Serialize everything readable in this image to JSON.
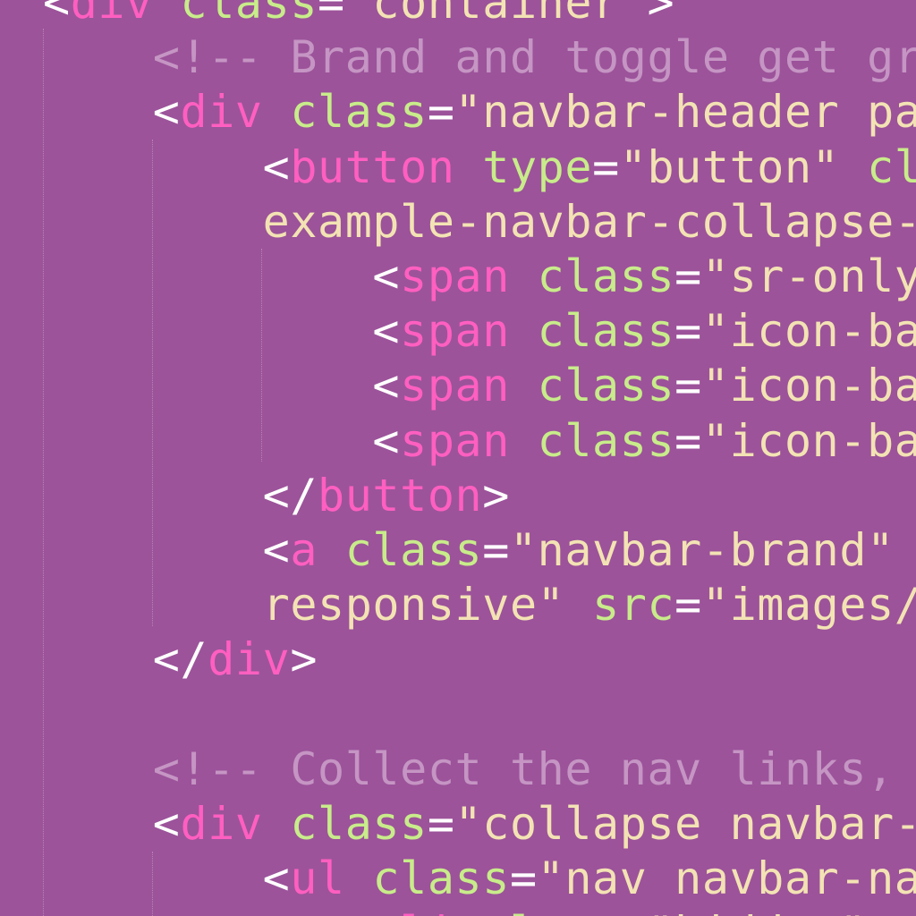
{
  "theme": {
    "background": "#9c539a",
    "tag": "#ff5fc0",
    "attribute": "#c8ec8a",
    "string": "#f3e3b4",
    "punctuation": "#ffffff",
    "comment": "#c595c3",
    "indent_guide": "rgba(255,255,255,0.28)"
  },
  "code_lines": [
    {
      "tokens": [
        {
          "t": "punc",
          "v": "<"
        },
        {
          "t": "tag",
          "v": "div"
        },
        {
          "t": "punc",
          "v": " "
        },
        {
          "t": "attr",
          "v": "class"
        },
        {
          "t": "punc",
          "v": "="
        },
        {
          "t": "str",
          "v": "\"container\""
        },
        {
          "t": "punc",
          "v": ">"
        }
      ]
    },
    {
      "tokens": [
        {
          "t": "punc",
          "v": "    "
        },
        {
          "t": "com",
          "v": "<!-- Brand and toggle get gr"
        }
      ]
    },
    {
      "tokens": [
        {
          "t": "punc",
          "v": "    <"
        },
        {
          "t": "tag",
          "v": "div"
        },
        {
          "t": "punc",
          "v": " "
        },
        {
          "t": "attr",
          "v": "class"
        },
        {
          "t": "punc",
          "v": "="
        },
        {
          "t": "str",
          "v": "\"navbar-header pa"
        }
      ]
    },
    {
      "tokens": [
        {
          "t": "punc",
          "v": "        <"
        },
        {
          "t": "tag",
          "v": "button"
        },
        {
          "t": "punc",
          "v": " "
        },
        {
          "t": "attr",
          "v": "type"
        },
        {
          "t": "punc",
          "v": "="
        },
        {
          "t": "str",
          "v": "\"button\" "
        },
        {
          "t": "attr",
          "v": "cl"
        }
      ]
    },
    {
      "tokens": [
        {
          "t": "str",
          "v": "        example-navbar-collapse-"
        }
      ]
    },
    {
      "tokens": [
        {
          "t": "punc",
          "v": "            <"
        },
        {
          "t": "tag",
          "v": "span"
        },
        {
          "t": "punc",
          "v": " "
        },
        {
          "t": "attr",
          "v": "class"
        },
        {
          "t": "punc",
          "v": "="
        },
        {
          "t": "str",
          "v": "\"sr-only"
        }
      ]
    },
    {
      "tokens": [
        {
          "t": "punc",
          "v": "            <"
        },
        {
          "t": "tag",
          "v": "span"
        },
        {
          "t": "punc",
          "v": " "
        },
        {
          "t": "attr",
          "v": "class"
        },
        {
          "t": "punc",
          "v": "="
        },
        {
          "t": "str",
          "v": "\"icon-ba"
        }
      ]
    },
    {
      "tokens": [
        {
          "t": "punc",
          "v": "            <"
        },
        {
          "t": "tag",
          "v": "span"
        },
        {
          "t": "punc",
          "v": " "
        },
        {
          "t": "attr",
          "v": "class"
        },
        {
          "t": "punc",
          "v": "="
        },
        {
          "t": "str",
          "v": "\"icon-ba"
        }
      ]
    },
    {
      "tokens": [
        {
          "t": "punc",
          "v": "            <"
        },
        {
          "t": "tag",
          "v": "span"
        },
        {
          "t": "punc",
          "v": " "
        },
        {
          "t": "attr",
          "v": "class"
        },
        {
          "t": "punc",
          "v": "="
        },
        {
          "t": "str",
          "v": "\"icon-ba"
        }
      ]
    },
    {
      "tokens": [
        {
          "t": "punc",
          "v": "        </"
        },
        {
          "t": "tag",
          "v": "button"
        },
        {
          "t": "punc",
          "v": ">"
        }
      ]
    },
    {
      "tokens": [
        {
          "t": "punc",
          "v": "        <"
        },
        {
          "t": "tag",
          "v": "a"
        },
        {
          "t": "punc",
          "v": " "
        },
        {
          "t": "attr",
          "v": "class"
        },
        {
          "t": "punc",
          "v": "="
        },
        {
          "t": "str",
          "v": "\"navbar-brand\" "
        }
      ]
    },
    {
      "tokens": [
        {
          "t": "str",
          "v": "        responsive\" "
        },
        {
          "t": "attr",
          "v": "src"
        },
        {
          "t": "punc",
          "v": "="
        },
        {
          "t": "str",
          "v": "\"images/"
        }
      ]
    },
    {
      "tokens": [
        {
          "t": "punc",
          "v": "    </"
        },
        {
          "t": "tag",
          "v": "div"
        },
        {
          "t": "punc",
          "v": ">"
        }
      ]
    },
    {
      "tokens": []
    },
    {
      "tokens": [
        {
          "t": "punc",
          "v": "    "
        },
        {
          "t": "com",
          "v": "<!-- Collect the nav links,"
        }
      ]
    },
    {
      "tokens": [
        {
          "t": "punc",
          "v": "    <"
        },
        {
          "t": "tag",
          "v": "div"
        },
        {
          "t": "punc",
          "v": " "
        },
        {
          "t": "attr",
          "v": "class"
        },
        {
          "t": "punc",
          "v": "="
        },
        {
          "t": "str",
          "v": "\"collapse navbar-"
        }
      ]
    },
    {
      "tokens": [
        {
          "t": "punc",
          "v": "        <"
        },
        {
          "t": "tag",
          "v": "ul"
        },
        {
          "t": "punc",
          "v": " "
        },
        {
          "t": "attr",
          "v": "class"
        },
        {
          "t": "punc",
          "v": "="
        },
        {
          "t": "str",
          "v": "\"nav navbar-na"
        }
      ]
    },
    {
      "tokens": [
        {
          "t": "punc",
          "v": "            <"
        },
        {
          "t": "tag",
          "v": "li"
        },
        {
          "t": "punc",
          "v": " "
        },
        {
          "t": "attr",
          "v": "class"
        },
        {
          "t": "punc",
          "v": "="
        },
        {
          "t": "str",
          "v": "\"hidden\""
        }
      ]
    }
  ]
}
